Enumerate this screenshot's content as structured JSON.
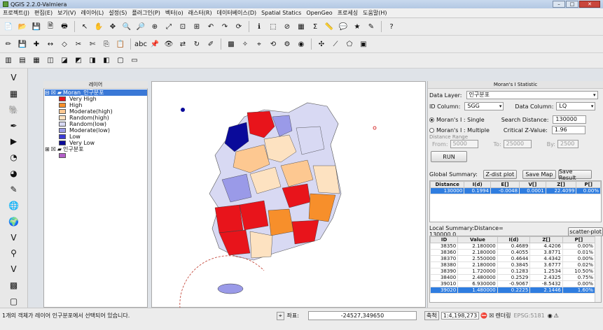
{
  "window": {
    "title": "QGIS 2.2.0-Valmiera"
  },
  "menu": [
    "프로젝트(J)",
    "편집(E)",
    "보기(V)",
    "레이어(L)",
    "설정(S)",
    "플러그인(P)",
    "벡터(o)",
    "래스터(R)",
    "데이터베이스(D)",
    "Spatial Statics",
    "OpenGeo",
    "프로세싱",
    "도움말(H)"
  ],
  "layer_panel": {
    "title": "레이어",
    "layers": [
      {
        "name": "Moran_인구분포",
        "selected": true
      },
      {
        "name": "인구분포",
        "selected": false
      }
    ],
    "legend": [
      {
        "label": "Very High",
        "color": "#e8141b"
      },
      {
        "label": "High",
        "color": "#f78f2b"
      },
      {
        "label": "Moderate(high)",
        "color": "#fdc891"
      },
      {
        "label": "Random(high)",
        "color": "#fde2c1"
      },
      {
        "label": "Random(low)",
        "color": "#d8d9f3"
      },
      {
        "label": "Moderate(low)",
        "color": "#9a9ae8"
      },
      {
        "label": "Low",
        "color": "#3b3bd6"
      },
      {
        "label": "Very Low",
        "color": "#0a0a9a"
      }
    ],
    "second_swatch_color": "#b45fc9"
  },
  "moran": {
    "title": "Moran's I Statistic",
    "data_layer_label": "Data Layer:",
    "data_layer_value": "인구분포",
    "id_column_label": "ID Column:",
    "id_column_value": "SGG",
    "data_column_label": "Data Column:",
    "data_column_value": "LQ",
    "single_label": "Moran's I : Single",
    "multiple_label": "Moran's I : Multiple",
    "search_distance_label": "Search Distance:",
    "search_distance_value": "130000",
    "critical_z_label": "Critical Z-Value:",
    "critical_z_value": "1.96",
    "distance_range_label": "Distance Range",
    "from_label": "From:",
    "from_value": "5000",
    "to_label": "To:",
    "to_value": "25000",
    "by_label": "By:",
    "by_value": "2500",
    "run_label": "RUN",
    "global_summary_label": "Global Summary:",
    "zdist_label": "Z-dist plot",
    "save_map_label": "Save Map",
    "save_result_label": "Save Result",
    "global_headers": [
      "Distance",
      "I(d)",
      "E[]",
      "V[]",
      "Z[]",
      "P[]"
    ],
    "global_rows": [
      [
        "130000",
        "0.1994",
        "-0.0048",
        "0.0001",
        "22.4099",
        "0.00%"
      ]
    ],
    "local_summary_label": "Local Summary:Distance= 130000.0",
    "scatter_label": "scatter-plot",
    "local_headers": [
      "ID",
      "Value",
      "I(d)",
      "Z[]",
      "P[]"
    ],
    "local_rows": [
      [
        "38350",
        "2.180000",
        "0.4689",
        "4.4206",
        "0.00%"
      ],
      [
        "38360",
        "2.180000",
        "0.4055",
        "3.8771",
        "0.01%"
      ],
      [
        "38370",
        "2.550000",
        "0.4644",
        "4.4342",
        "0.00%"
      ],
      [
        "38380",
        "2.180000",
        "0.3845",
        "3.6777",
        "0.02%"
      ],
      [
        "38390",
        "1.720000",
        "0.1283",
        "1.2534",
        "10.50%"
      ],
      [
        "38400",
        "2.480000",
        "0.2529",
        "2.4325",
        "0.75%"
      ],
      [
        "39010",
        "6.930000",
        "-0.9067",
        "-8.5432",
        "0.00%"
      ],
      [
        "39020",
        "1.480000",
        "0.2225",
        "2.1446",
        "1.60%"
      ]
    ]
  },
  "status": {
    "message": "1개의 객체가 레이어 인구분포에서 선택되어 있습니다.",
    "coord_label": "좌표:",
    "coord_value": "-24527,349650",
    "scale_label": "축척",
    "scale_value": "1:4,198,273",
    "render_label": "렌더링",
    "epsg": "EPSG:5181"
  }
}
